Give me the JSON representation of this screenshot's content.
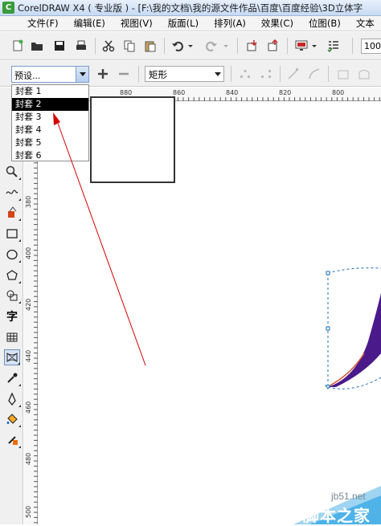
{
  "window": {
    "title": "CorelDRAW X4 ( 专业版 ) - [F:\\我的文档\\我的源文件作品\\百度\\百度经验\\3D立体字"
  },
  "menu": [
    "文件(F)",
    "编辑(E)",
    "视图(V)",
    "版面(L)",
    "排列(A)",
    "效果(C)",
    "位图(B)",
    "文本"
  ],
  "toolbar": {
    "zoom": "100%"
  },
  "property_bar": {
    "preset_value": "预设...",
    "shape_value": "矩形"
  },
  "preset_dropdown": {
    "items": [
      "封套 1",
      "封套 2",
      "封套 3",
      "封套 4",
      "封套 5",
      "封套 6"
    ],
    "selected_index": 1
  },
  "rulers": {
    "horizontal": [
      "880",
      "860",
      "840",
      "820",
      "800"
    ],
    "vertical": [
      "380",
      "400",
      "420",
      "440",
      "460",
      "480",
      "500"
    ]
  },
  "toolbox": {
    "text_tool_glyph": "字"
  },
  "watermark": {
    "line1": "jb51.net",
    "line2": "脚本之家"
  },
  "colors": {
    "annotation_arrow": "#d40000",
    "envelope_fill": "#4a1a8a",
    "selected_item_bg": "#000000"
  }
}
